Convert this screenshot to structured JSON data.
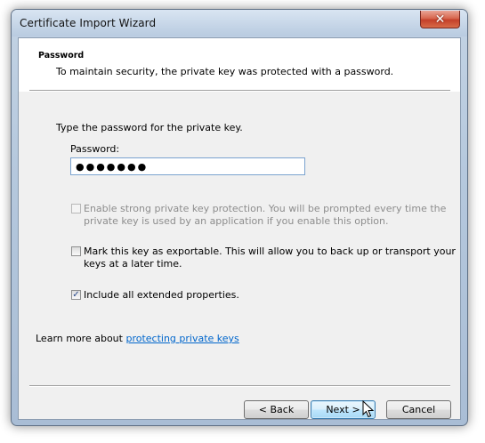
{
  "window": {
    "title": "Certificate Import Wizard",
    "close_label": "✕"
  },
  "header": {
    "title": "Password",
    "description": "To maintain security, the private key was protected with a password."
  },
  "body": {
    "prompt": "Type the password for the private key.",
    "password_label": "Password:",
    "password_value": "●●●●●●●",
    "strong_protection": {
      "line1": "Enable strong private key protection. You will be prompted every time the",
      "line2": "private key is used by an application if you enable this option.",
      "checked": false,
      "enabled": false
    },
    "exportable": {
      "line1": "Mark this key as exportable. This will allow you to back up or transport your",
      "line2": "keys at a later time.",
      "checked": false
    },
    "extended_properties": {
      "label": "Include all extended properties.",
      "checked": true,
      "check_glyph": "✓"
    },
    "learn_more_prefix": "Learn more about ",
    "learn_more_link": "protecting private keys"
  },
  "buttons": {
    "back": "< Back",
    "next": "Next >",
    "cancel": "Cancel"
  }
}
